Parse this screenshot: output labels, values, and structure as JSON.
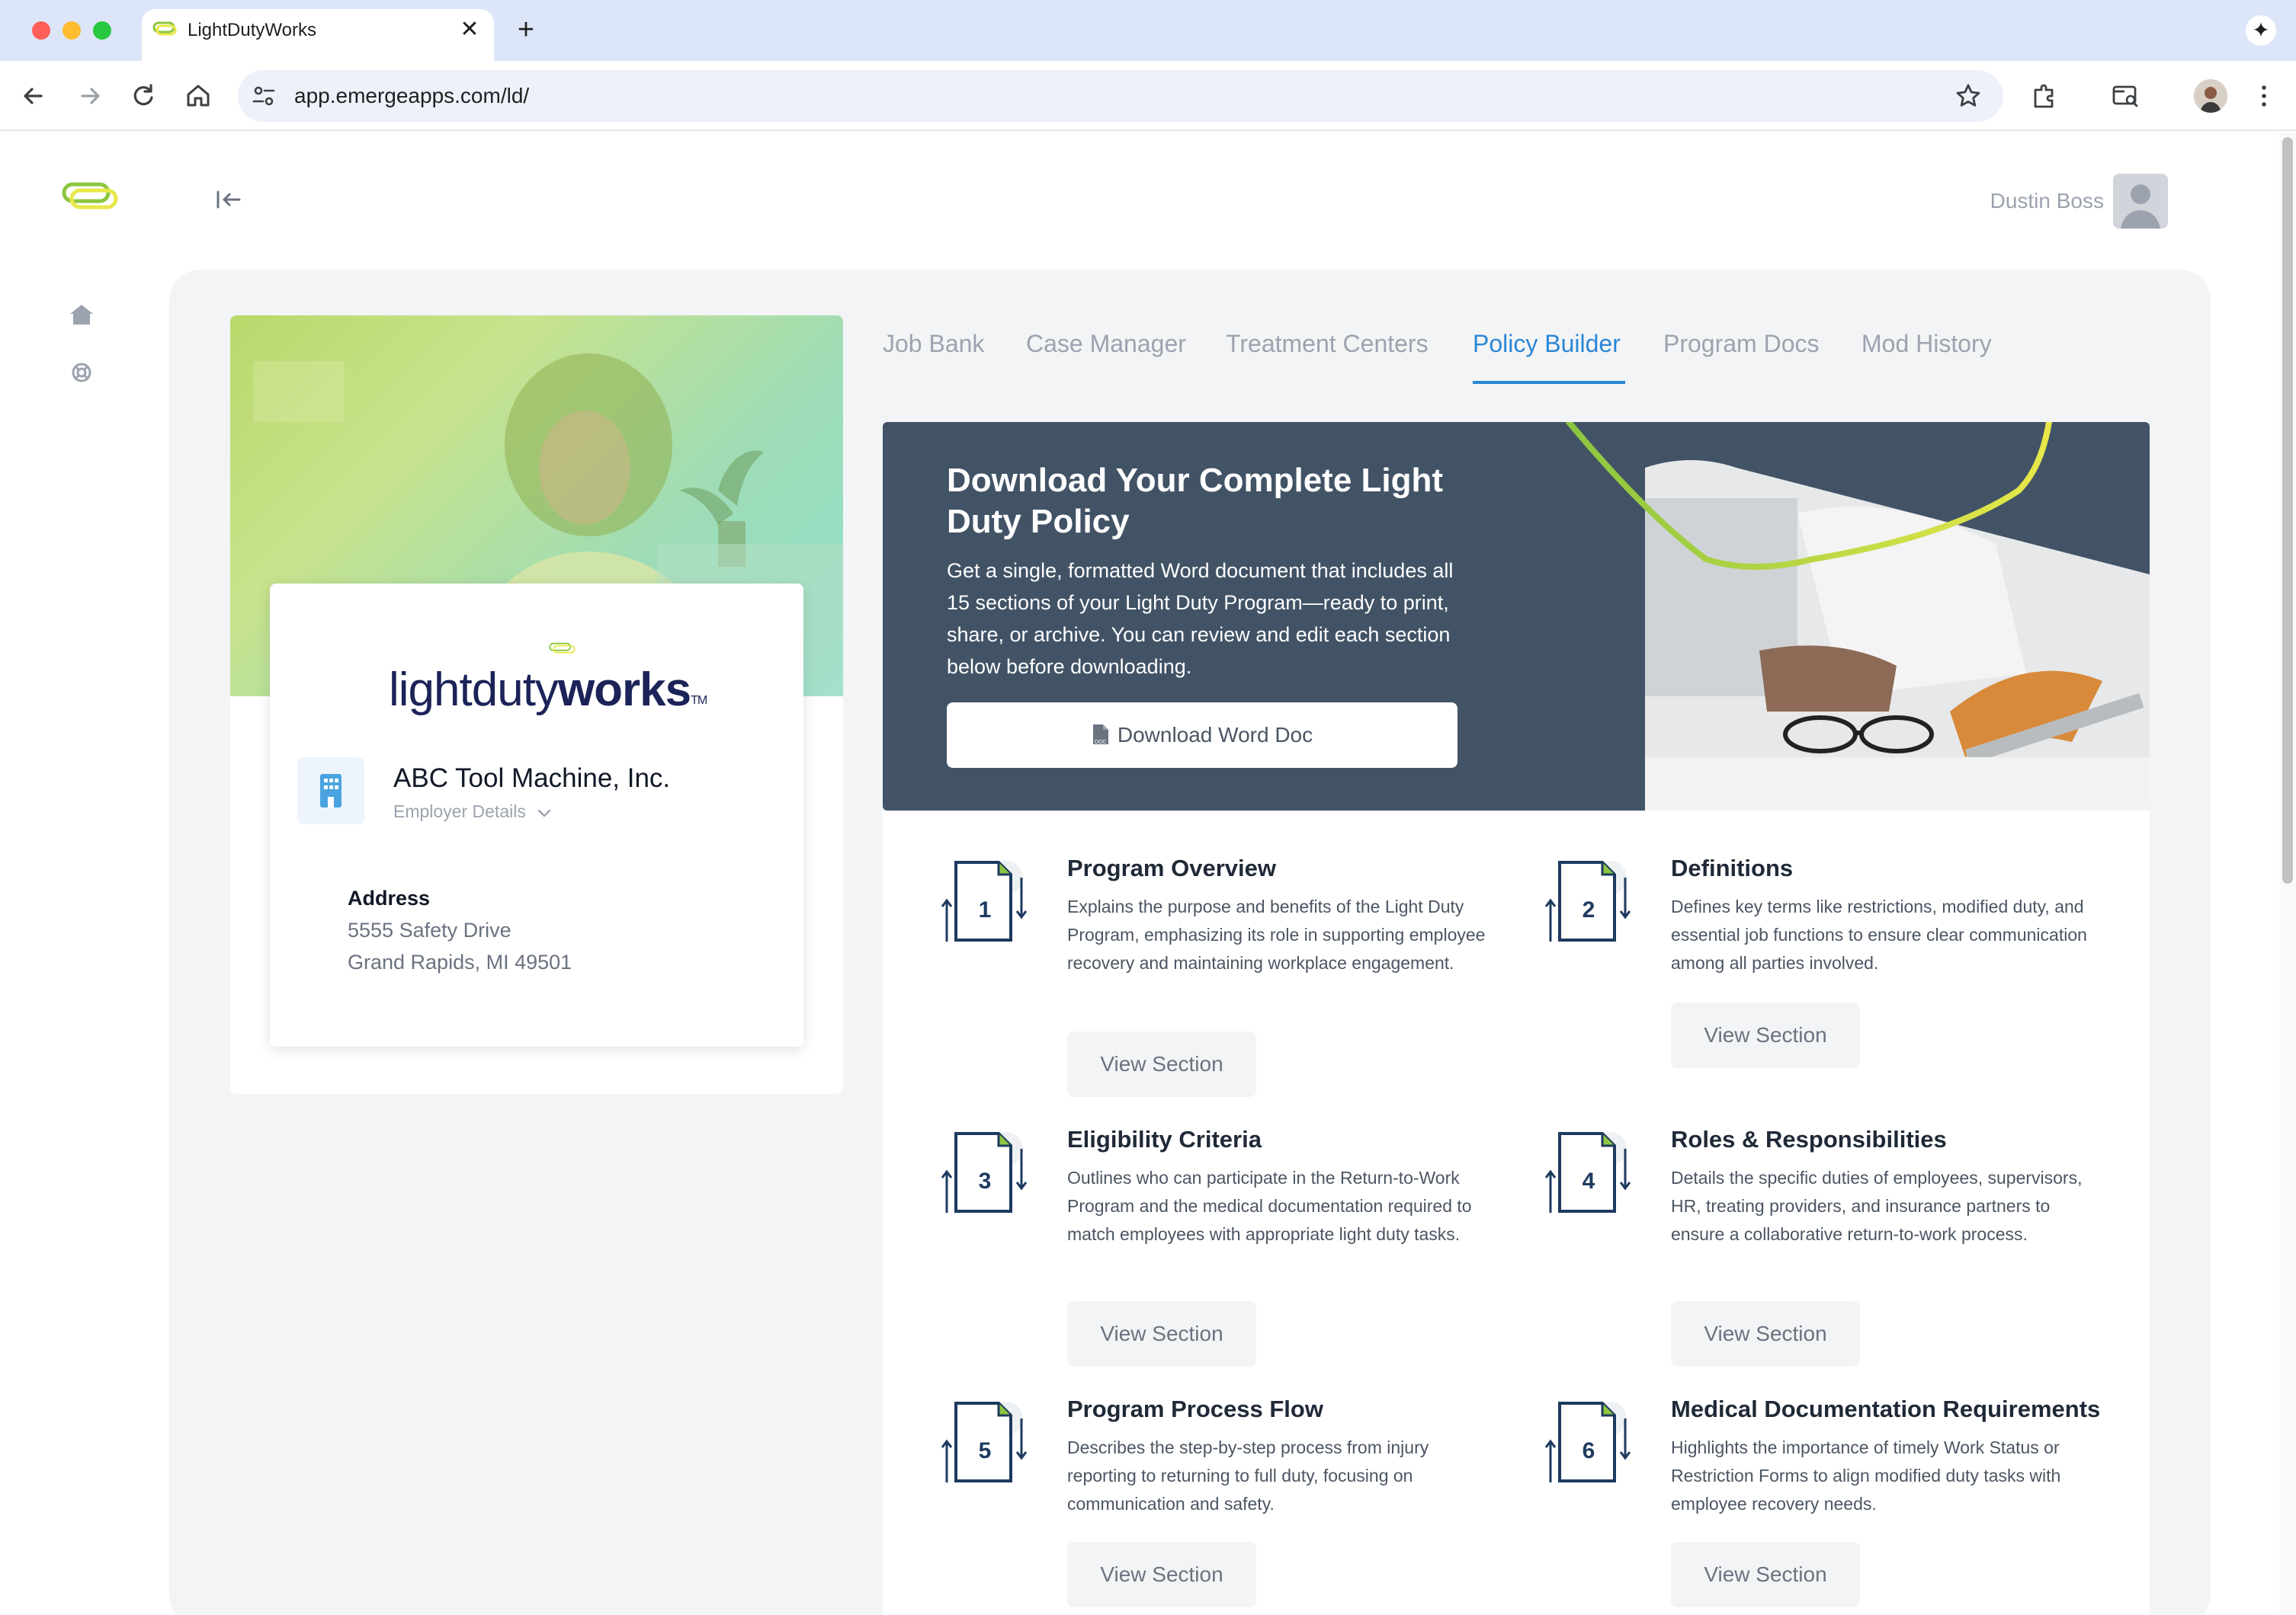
{
  "browser": {
    "tab_title": "LightDutyWorks",
    "tab_close": "✕",
    "new_tab": "+",
    "url": "app.emergeapps.com/ld/"
  },
  "header": {
    "user_name": "Dustin Boss"
  },
  "employer": {
    "brand_light": "lightduty",
    "brand_bold": "works",
    "brand_tm": "TM",
    "company_name": "ABC Tool Machine, Inc.",
    "details_label": "Employer Details",
    "address_label": "Address",
    "address_line1": "5555 Safety Drive",
    "address_line2": "Grand Rapids, MI 49501"
  },
  "tabs": [
    {
      "label": "Job Bank",
      "active": false
    },
    {
      "label": "Case Manager",
      "active": false
    },
    {
      "label": "Treatment Centers",
      "active": false
    },
    {
      "label": "Policy Builder",
      "active": true
    },
    {
      "label": "Program Docs",
      "active": false
    },
    {
      "label": "Mod History",
      "active": false
    }
  ],
  "banner": {
    "title": "Download Your Complete Light Duty Policy",
    "description": "Get a single, formatted Word document that includes all 15 sections of your Light Duty Program—ready to print, share, or archive. You can review and edit each section below before downloading.",
    "button_label": "Download Word Doc"
  },
  "sections": [
    {
      "number": "1",
      "title": "Program Overview",
      "description": "Explains the purpose and benefits of the Light Duty Program, emphasizing its role in supporting employee recovery and maintaining workplace engagement.",
      "button_label": "View Section"
    },
    {
      "number": "2",
      "title": "Definitions",
      "description": "Defines key terms like restrictions, modified duty, and essential job functions to ensure clear communication among all parties involved.",
      "button_label": "View Section"
    },
    {
      "number": "3",
      "title": "Eligibility Criteria",
      "description": "Outlines who can participate in the Return-to-Work Program and the medical documentation required to match employees with appropriate light duty tasks.",
      "button_label": "View Section"
    },
    {
      "number": "4",
      "title": "Roles & Responsibilities",
      "description": "Details the specific duties of employees, supervisors, HR, treating providers, and insurance partners to ensure a collaborative return-to-work process.",
      "button_label": "View Section"
    },
    {
      "number": "5",
      "title": "Program Process Flow",
      "description": "Describes the step-by-step process from injury reporting to returning to full duty, focusing on communication and safety.",
      "button_label": "View Section"
    },
    {
      "number": "6",
      "title": "Medical Documentation Requirements",
      "description": "Highlights the importance of timely Work Status or Restriction Forms to align modified duty tasks with employee recovery needs.",
      "button_label": "View Section"
    }
  ],
  "colors": {
    "accent": "#2b86d6",
    "banner_bg": "#425366",
    "brand_green": "#8cc63f",
    "brand_yellow": "#e8e84a",
    "brand_navy": "#1b2358"
  }
}
